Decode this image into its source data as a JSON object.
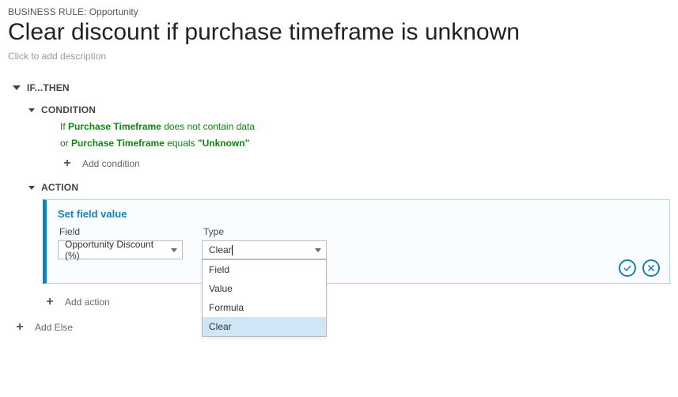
{
  "header": {
    "breadcrumb": "BUSINESS RULE: Opportunity",
    "title": "Clear discount if purchase timeframe is unknown",
    "description_placeholder": "Click to add description"
  },
  "ifthen": {
    "label": "IF...THEN"
  },
  "condition": {
    "label": "CONDITION",
    "lines": [
      {
        "pre": "If ",
        "field": "Purchase Timeframe",
        "op": " does not contain data",
        "val": ""
      },
      {
        "pre": "or ",
        "field": "Purchase Timeframe",
        "op": " equals ",
        "val": "\"Unknown\""
      }
    ],
    "add_label": "Add condition"
  },
  "action": {
    "label": "ACTION",
    "card": {
      "title": "Set field value",
      "field_label": "Field",
      "field_value": "Opportunity Discount (%)",
      "type_label": "Type",
      "type_value": "Clear",
      "dropdown": [
        "Field",
        "Value",
        "Formula",
        "Clear"
      ],
      "selected": "Clear"
    },
    "add_label": "Add action"
  },
  "else": {
    "add_label": "Add Else"
  }
}
